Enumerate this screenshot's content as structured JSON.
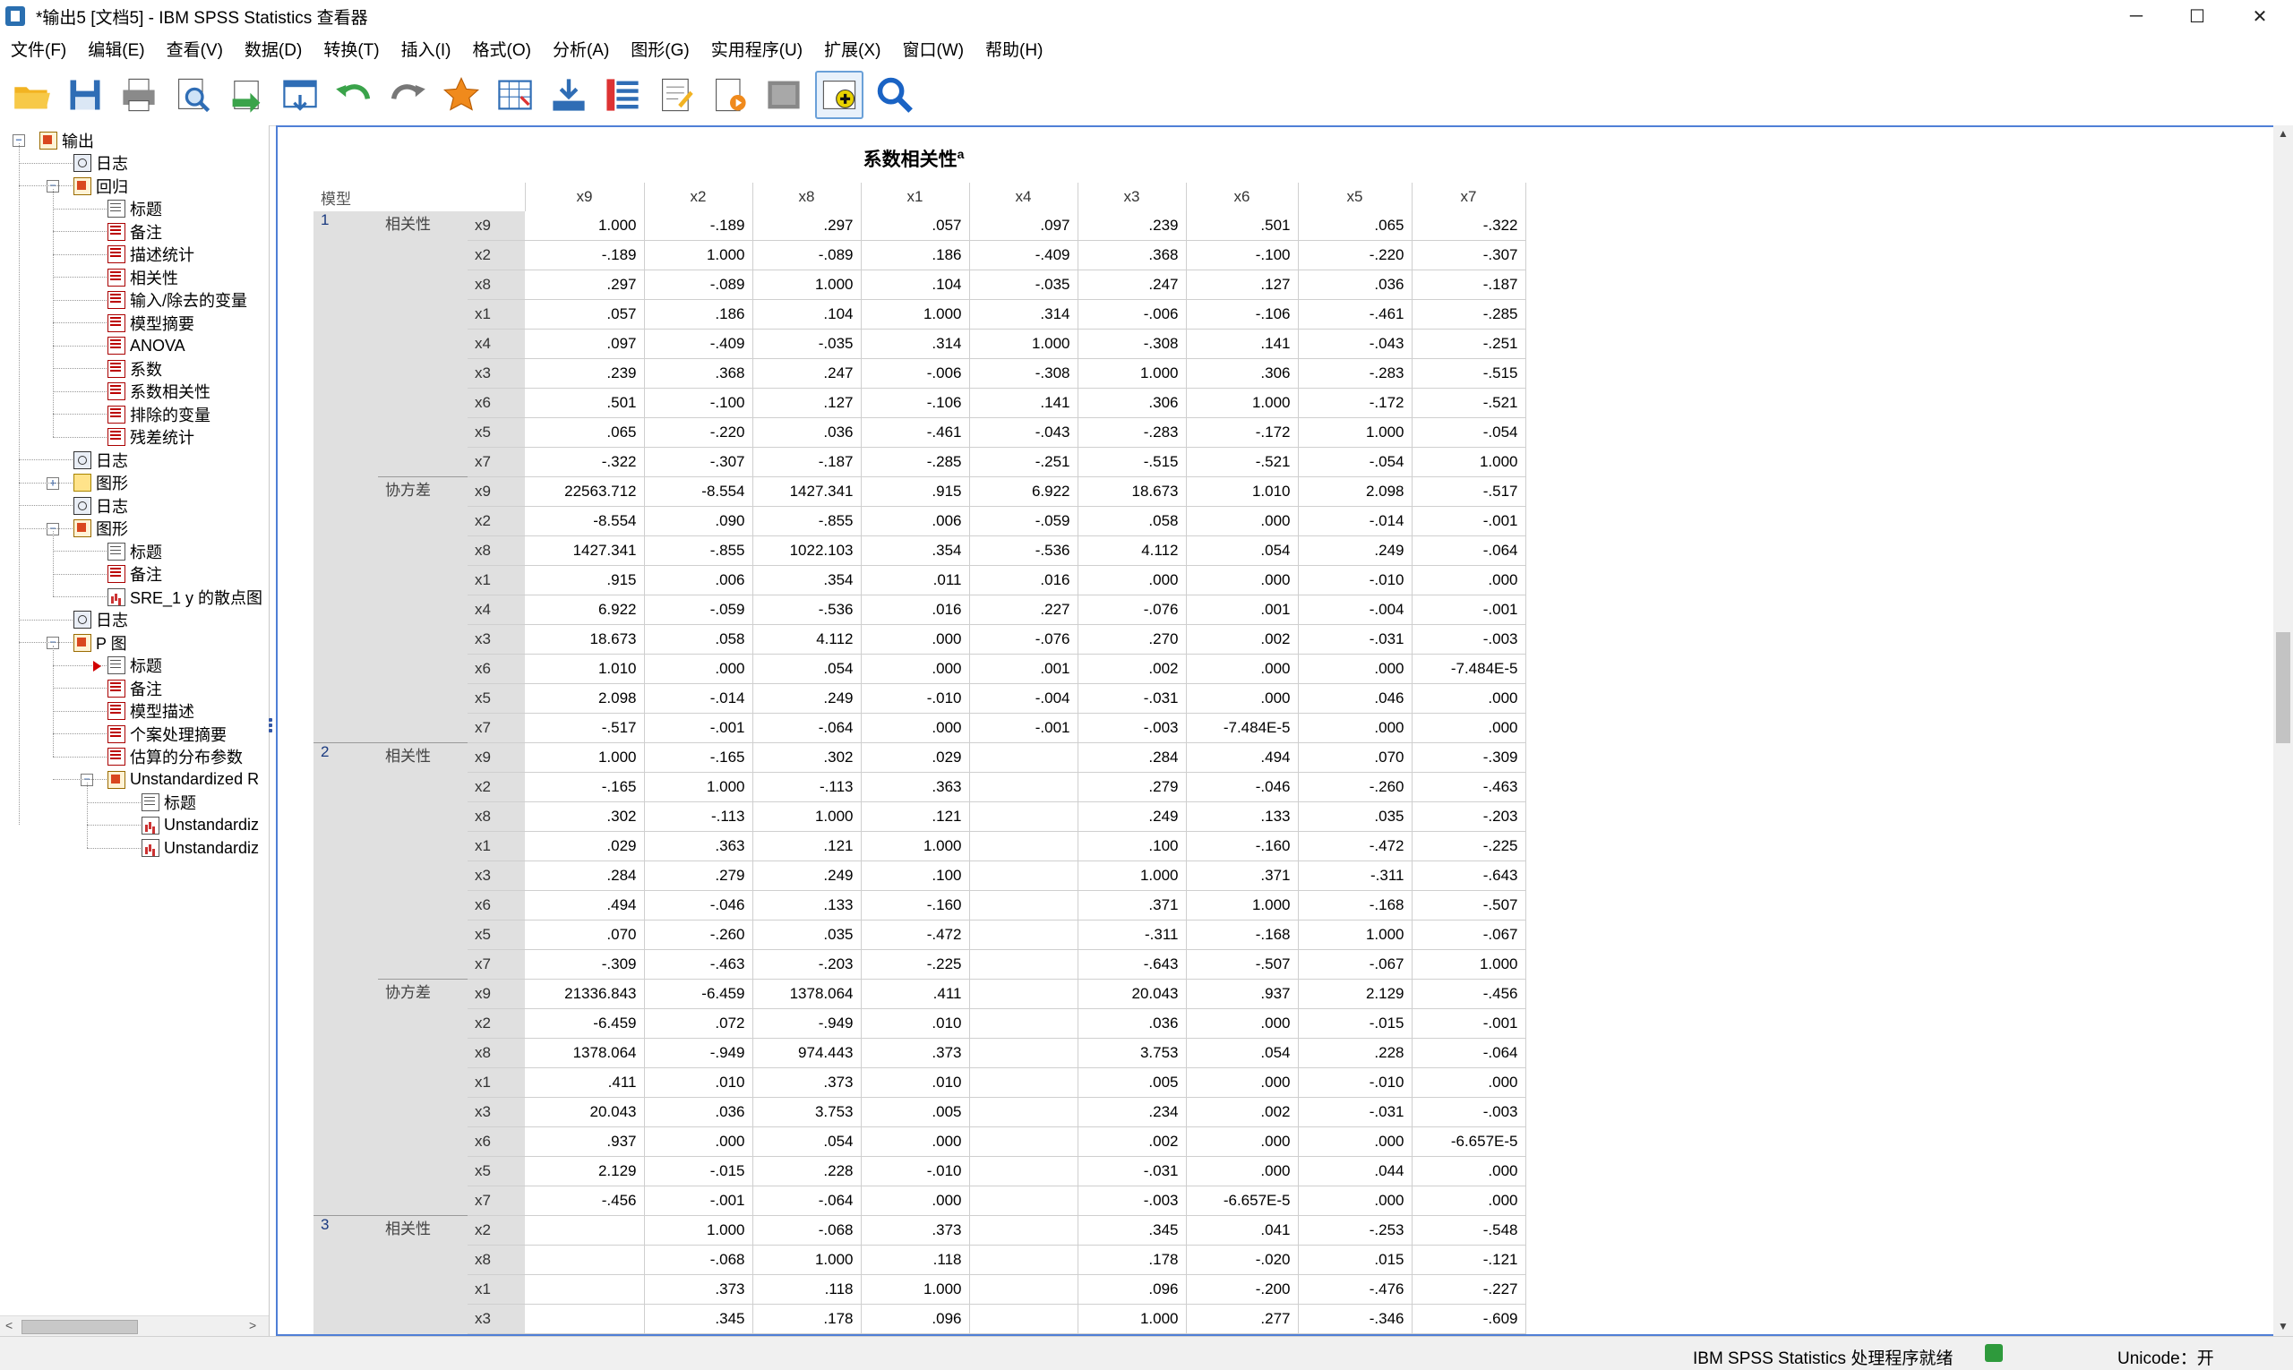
{
  "window": {
    "title": "*输出5 [文档5] - IBM SPSS Statistics 查看器",
    "minimize": "─",
    "maximize": "☐",
    "close": "✕"
  },
  "menu": [
    "文件(F)",
    "编辑(E)",
    "查看(V)",
    "数据(D)",
    "转换(T)",
    "插入(I)",
    "格式(O)",
    "分析(A)",
    "图形(G)",
    "实用程序(U)",
    "扩展(X)",
    "窗口(W)",
    "帮助(H)"
  ],
  "toolbar": [
    "open-icon",
    "save-icon",
    "print-icon",
    "print-preview-icon",
    "export-icon",
    "goto-data-icon",
    "undo-icon",
    "redo-icon",
    "goto-output-icon",
    "goto-case-icon",
    "goto-variable-icon",
    "variables-icon",
    "output-designate-icon",
    "script-icon",
    "run-script-icon",
    "hide-icon",
    "insert-icon",
    "search-icon"
  ],
  "tree": {
    "nodes": [
      {
        "label": "输出",
        "icon": "book",
        "level": 0
      },
      {
        "label": "日志",
        "icon": "log",
        "level": 1
      },
      {
        "label": "回归",
        "icon": "book",
        "level": 1
      },
      {
        "label": "标题",
        "icon": "tbl",
        "level": 2
      },
      {
        "label": "备注",
        "icon": "redtbl",
        "level": 2
      },
      {
        "label": "描述统计",
        "icon": "redtbl",
        "level": 2
      },
      {
        "label": "相关性",
        "icon": "redtbl",
        "level": 2
      },
      {
        "label": "输入/除去的变量",
        "icon": "redtbl",
        "level": 2
      },
      {
        "label": "模型摘要",
        "icon": "redtbl",
        "level": 2
      },
      {
        "label": "ANOVA",
        "icon": "redtbl",
        "level": 2
      },
      {
        "label": "系数",
        "icon": "redtbl",
        "level": 2
      },
      {
        "label": "系数相关性",
        "icon": "redtbl",
        "level": 2
      },
      {
        "label": "排除的变量",
        "icon": "redtbl",
        "level": 2
      },
      {
        "label": "残差统计",
        "icon": "redtbl",
        "level": 2
      },
      {
        "label": "日志",
        "icon": "log",
        "level": 1
      },
      {
        "label": "图形",
        "icon": "folder",
        "level": 1
      },
      {
        "label": "日志",
        "icon": "log",
        "level": 1
      },
      {
        "label": "图形",
        "icon": "book",
        "level": 1
      },
      {
        "label": "标题",
        "icon": "tbl",
        "level": 2
      },
      {
        "label": "备注",
        "icon": "redtbl",
        "level": 2
      },
      {
        "label": "SRE_1 y 的散点图",
        "icon": "chart",
        "level": 2
      },
      {
        "label": "日志",
        "icon": "log",
        "level": 1
      },
      {
        "label": "P 图",
        "icon": "book",
        "level": 1
      },
      {
        "label": "标题",
        "icon": "tbl",
        "level": 2
      },
      {
        "label": "备注",
        "icon": "redtbl",
        "level": 2
      },
      {
        "label": "模型描述",
        "icon": "redtbl",
        "level": 2
      },
      {
        "label": "个案处理摘要",
        "icon": "redtbl",
        "level": 2
      },
      {
        "label": "估算的分布参数",
        "icon": "redtbl",
        "level": 2
      },
      {
        "label": "Unstandardized R",
        "icon": "book",
        "level": 2
      },
      {
        "label": "标题",
        "icon": "tbl",
        "level": 3
      },
      {
        "label": "Unstandardiz",
        "icon": "chart",
        "level": 3
      },
      {
        "label": "Unstandardiz",
        "icon": "chart",
        "level": 3
      }
    ]
  },
  "table": {
    "title": "系数相关性",
    "superscript": "a",
    "model_header": "模型",
    "columns": [
      "x9",
      "x2",
      "x8",
      "x1",
      "x4",
      "x3",
      "x6",
      "x5",
      "x7"
    ],
    "blocks": [
      {
        "model": "1",
        "type": "相关性",
        "rows": [
          {
            "var": "x9",
            "vals": [
              "1.000",
              "-.189",
              ".297",
              ".057",
              ".097",
              ".239",
              ".501",
              ".065",
              "-.322"
            ]
          },
          {
            "var": "x2",
            "vals": [
              "-.189",
              "1.000",
              "-.089",
              ".186",
              "-.409",
              ".368",
              "-.100",
              "-.220",
              "-.307"
            ]
          },
          {
            "var": "x8",
            "vals": [
              ".297",
              "-.089",
              "1.000",
              ".104",
              "-.035",
              ".247",
              ".127",
              ".036",
              "-.187"
            ]
          },
          {
            "var": "x1",
            "vals": [
              ".057",
              ".186",
              ".104",
              "1.000",
              ".314",
              "-.006",
              "-.106",
              "-.461",
              "-.285"
            ]
          },
          {
            "var": "x4",
            "vals": [
              ".097",
              "-.409",
              "-.035",
              ".314",
              "1.000",
              "-.308",
              ".141",
              "-.043",
              "-.251"
            ]
          },
          {
            "var": "x3",
            "vals": [
              ".239",
              ".368",
              ".247",
              "-.006",
              "-.308",
              "1.000",
              ".306",
              "-.283",
              "-.515"
            ]
          },
          {
            "var": "x6",
            "vals": [
              ".501",
              "-.100",
              ".127",
              "-.106",
              ".141",
              ".306",
              "1.000",
              "-.172",
              "-.521"
            ]
          },
          {
            "var": "x5",
            "vals": [
              ".065",
              "-.220",
              ".036",
              "-.461",
              "-.043",
              "-.283",
              "-.172",
              "1.000",
              "-.054"
            ]
          },
          {
            "var": "x7",
            "vals": [
              "-.322",
              "-.307",
              "-.187",
              "-.285",
              "-.251",
              "-.515",
              "-.521",
              "-.054",
              "1.000"
            ]
          }
        ]
      },
      {
        "model": "",
        "type": "协方差",
        "rows": [
          {
            "var": "x9",
            "vals": [
              "22563.712",
              "-8.554",
              "1427.341",
              ".915",
              "6.922",
              "18.673",
              "1.010",
              "2.098",
              "-.517"
            ]
          },
          {
            "var": "x2",
            "vals": [
              "-8.554",
              ".090",
              "-.855",
              ".006",
              "-.059",
              ".058",
              ".000",
              "-.014",
              "-.001"
            ]
          },
          {
            "var": "x8",
            "vals": [
              "1427.341",
              "-.855",
              "1022.103",
              ".354",
              "-.536",
              "4.112",
              ".054",
              ".249",
              "-.064"
            ]
          },
          {
            "var": "x1",
            "vals": [
              ".915",
              ".006",
              ".354",
              ".011",
              ".016",
              ".000",
              ".000",
              "-.010",
              ".000"
            ]
          },
          {
            "var": "x4",
            "vals": [
              "6.922",
              "-.059",
              "-.536",
              ".016",
              ".227",
              "-.076",
              ".001",
              "-.004",
              "-.001"
            ]
          },
          {
            "var": "x3",
            "vals": [
              "18.673",
              ".058",
              "4.112",
              ".000",
              "-.076",
              ".270",
              ".002",
              "-.031",
              "-.003"
            ]
          },
          {
            "var": "x6",
            "vals": [
              "1.010",
              ".000",
              ".054",
              ".000",
              ".001",
              ".002",
              ".000",
              ".000",
              "-7.484E-5"
            ]
          },
          {
            "var": "x5",
            "vals": [
              "2.098",
              "-.014",
              ".249",
              "-.010",
              "-.004",
              "-.031",
              ".000",
              ".046",
              ".000"
            ]
          },
          {
            "var": "x7",
            "vals": [
              "-.517",
              "-.001",
              "-.064",
              ".000",
              "-.001",
              "-.003",
              "-7.484E-5",
              ".000",
              ".000"
            ]
          }
        ]
      },
      {
        "model": "2",
        "type": "相关性",
        "rows": [
          {
            "var": "x9",
            "vals": [
              "1.000",
              "-.165",
              ".302",
              ".029",
              "",
              ".284",
              ".494",
              ".070",
              "-.309"
            ]
          },
          {
            "var": "x2",
            "vals": [
              "-.165",
              "1.000",
              "-.113",
              ".363",
              "",
              ".279",
              "-.046",
              "-.260",
              "-.463"
            ]
          },
          {
            "var": "x8",
            "vals": [
              ".302",
              "-.113",
              "1.000",
              ".121",
              "",
              ".249",
              ".133",
              ".035",
              "-.203"
            ]
          },
          {
            "var": "x1",
            "vals": [
              ".029",
              ".363",
              ".121",
              "1.000",
              "",
              ".100",
              "-.160",
              "-.472",
              "-.225"
            ]
          },
          {
            "var": "x3",
            "vals": [
              ".284",
              ".279",
              ".249",
              ".100",
              "",
              "1.000",
              ".371",
              "-.311",
              "-.643"
            ]
          },
          {
            "var": "x6",
            "vals": [
              ".494",
              "-.046",
              ".133",
              "-.160",
              "",
              ".371",
              "1.000",
              "-.168",
              "-.507"
            ]
          },
          {
            "var": "x5",
            "vals": [
              ".070",
              "-.260",
              ".035",
              "-.472",
              "",
              "-.311",
              "-.168",
              "1.000",
              "-.067"
            ]
          },
          {
            "var": "x7",
            "vals": [
              "-.309",
              "-.463",
              "-.203",
              "-.225",
              "",
              "-.643",
              "-.507",
              "-.067",
              "1.000"
            ]
          }
        ]
      },
      {
        "model": "",
        "type": "协方差",
        "rows": [
          {
            "var": "x9",
            "vals": [
              "21336.843",
              "-6.459",
              "1378.064",
              ".411",
              "",
              "20.043",
              ".937",
              "2.129",
              "-.456"
            ]
          },
          {
            "var": "x2",
            "vals": [
              "-6.459",
              ".072",
              "-.949",
              ".010",
              "",
              ".036",
              ".000",
              "-.015",
              "-.001"
            ]
          },
          {
            "var": "x8",
            "vals": [
              "1378.064",
              "-.949",
              "974.443",
              ".373",
              "",
              "3.753",
              ".054",
              ".228",
              "-.064"
            ]
          },
          {
            "var": "x1",
            "vals": [
              ".411",
              ".010",
              ".373",
              ".010",
              "",
              ".005",
              ".000",
              "-.010",
              ".000"
            ]
          },
          {
            "var": "x3",
            "vals": [
              "20.043",
              ".036",
              "3.753",
              ".005",
              "",
              ".234",
              ".002",
              "-.031",
              "-.003"
            ]
          },
          {
            "var": "x6",
            "vals": [
              ".937",
              ".000",
              ".054",
              ".000",
              "",
              ".002",
              ".000",
              ".000",
              "-6.657E-5"
            ]
          },
          {
            "var": "x5",
            "vals": [
              "2.129",
              "-.015",
              ".228",
              "-.010",
              "",
              "-.031",
              ".000",
              ".044",
              ".000"
            ]
          },
          {
            "var": "x7",
            "vals": [
              "-.456",
              "-.001",
              "-.064",
              ".000",
              "",
              "-.003",
              "-6.657E-5",
              ".000",
              ".000"
            ]
          }
        ]
      },
      {
        "model": "3",
        "type": "相关性",
        "rows": [
          {
            "var": "x2",
            "vals": [
              "",
              "1.000",
              "-.068",
              ".373",
              "",
              ".345",
              ".041",
              "-.253",
              "-.548"
            ]
          },
          {
            "var": "x8",
            "vals": [
              "",
              "-.068",
              "1.000",
              ".118",
              "",
              ".178",
              "-.020",
              ".015",
              "-.121"
            ]
          },
          {
            "var": "x1",
            "vals": [
              "",
              ".373",
              ".118",
              "1.000",
              "",
              ".096",
              "-.200",
              "-.476",
              "-.227"
            ]
          },
          {
            "var": "x3",
            "vals": [
              "",
              ".345",
              ".178",
              ".096",
              "",
              "1.000",
              ".277",
              "-.346",
              "-.609"
            ]
          }
        ]
      }
    ]
  },
  "status": {
    "processor": "IBM SPSS Statistics 处理程序就绪",
    "unicode": "Unicode：开"
  }
}
